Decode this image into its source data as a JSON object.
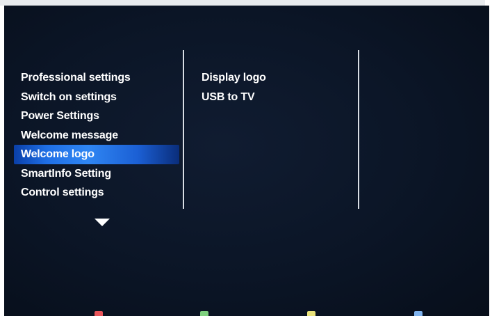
{
  "menu": {
    "items": [
      {
        "label": "Professional settings"
      },
      {
        "label": "Switch on settings"
      },
      {
        "label": "Power Settings"
      },
      {
        "label": "Welcome message"
      },
      {
        "label": "Welcome logo",
        "selected": true
      },
      {
        "label": "SmartInfo Setting"
      },
      {
        "label": "Control settings"
      }
    ],
    "scroll_indicator_icon": "triangle-down-icon"
  },
  "submenu": {
    "items": [
      {
        "label": "Display logo"
      },
      {
        "label": "USB to TV"
      }
    ]
  },
  "color_keys": [
    {
      "name": "red",
      "color": "#e8555a"
    },
    {
      "name": "green",
      "color": "#7ed07e"
    },
    {
      "name": "yellow",
      "color": "#e9e27a"
    },
    {
      "name": "blue",
      "color": "#7fb3ee"
    }
  ],
  "colors": {
    "background": "#0b1526",
    "highlight": "#2f86f3",
    "text": "#ffffff"
  }
}
